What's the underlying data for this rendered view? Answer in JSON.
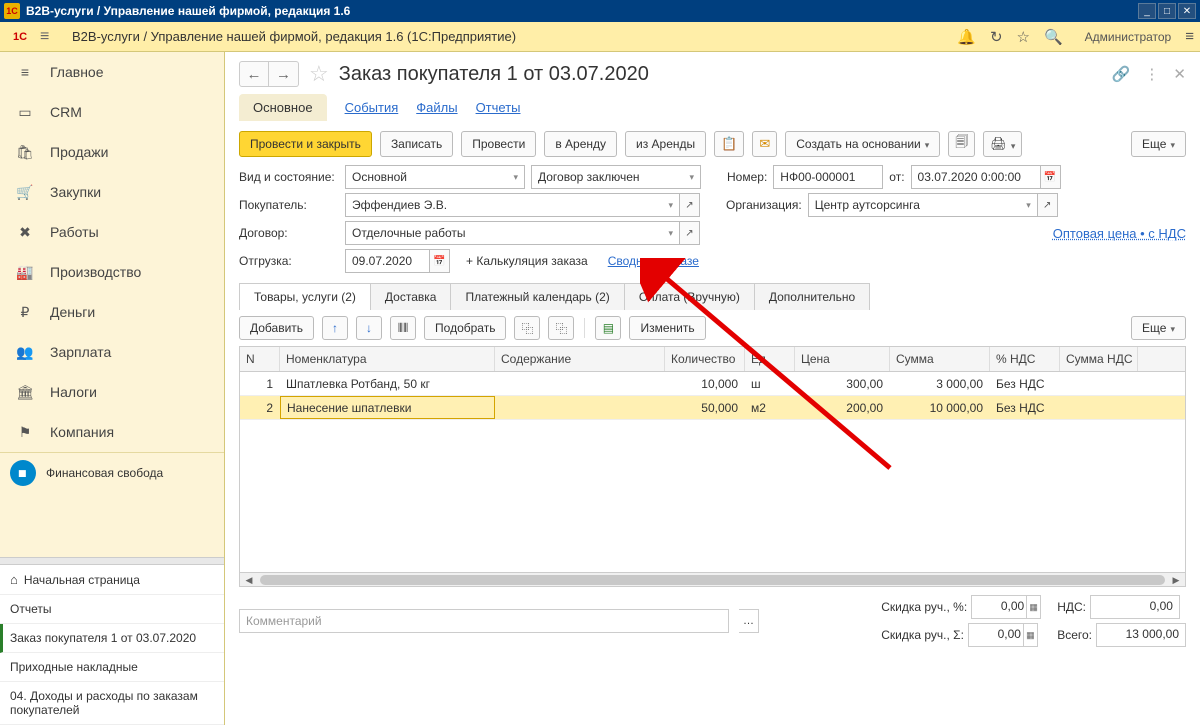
{
  "titlebar": {
    "text": "В2В-услуги / Управление нашей фирмой, редакция 1.6"
  },
  "header": {
    "breadcrumb": "В2В-услуги / Управление нашей фирмой, редакция 1.6  (1С:Предприятие)",
    "user": "Администратор"
  },
  "sidebar": {
    "items": [
      {
        "icon": "≡",
        "label": "Главное"
      },
      {
        "icon": "▭",
        "label": "CRM"
      },
      {
        "icon": "🛍",
        "label": "Продажи"
      },
      {
        "icon": "🛒",
        "label": "Закупки"
      },
      {
        "icon": "✖",
        "label": "Работы"
      },
      {
        "icon": "🏭",
        "label": "Производство"
      },
      {
        "icon": "₽",
        "label": "Деньги"
      },
      {
        "icon": "👥",
        "label": "Зарплата"
      },
      {
        "icon": "🏛",
        "label": "Налоги"
      },
      {
        "icon": "⚑",
        "label": "Компания"
      }
    ],
    "fin": "Финансовая свобода",
    "bottom": [
      "Начальная страница",
      "Отчеты",
      "Заказ покупателя 1 от 03.07.2020",
      "Приходные накладные",
      "04. Доходы и расходы по заказам покупателей"
    ]
  },
  "doc": {
    "title": "Заказ покупателя 1 от 03.07.2020",
    "tabs": {
      "main": "Основное",
      "events": "События",
      "files": "Файлы",
      "reports": "Отчеты"
    },
    "cmd": {
      "post_close": "Провести и закрыть",
      "save": "Записать",
      "post": "Провести",
      "rent_to": "в Аренду",
      "rent_from": "из Аренды",
      "create_base": "Создать на основании",
      "more": "Еще"
    },
    "fields": {
      "type_label": "Вид и состояние:",
      "type_val": "Основной",
      "status_val": "Договор заключен",
      "num_label": "Номер:",
      "num_val": "НФ00-000001",
      "from_label": "от:",
      "from_val": "03.07.2020  0:00:00",
      "buyer_label": "Покупатель:",
      "buyer_val": "Эффендиев Э.В.",
      "org_label": "Организация:",
      "org_val": "Центр аутсорсинга",
      "contract_label": "Договор:",
      "contract_val": "Отделочные работы",
      "price_link": "Оптовая цена • с НДС",
      "ship_label": "Отгрузка:",
      "ship_val": "09.07.2020",
      "calc_link": "+ Калькуляция заказа",
      "summary_link": "Сводно о заказе"
    },
    "inner_tabs": [
      "Товары, услуги (2)",
      "Доставка",
      "Платежный календарь (2)",
      "Оплата (Вручную)",
      "Дополнительно"
    ],
    "tbl_cmd": {
      "add": "Добавить",
      "pick": "Подобрать",
      "edit": "Изменить",
      "more": "Еще"
    },
    "cols": {
      "n": "N",
      "nom": "Номенклатура",
      "cont": "Содержание",
      "qty": "Количество",
      "unit": "Ед.",
      "price": "Цена",
      "sum": "Сумма",
      "vat": "% НДС",
      "vatsum": "Сумма НДС"
    },
    "rows": [
      {
        "n": "1",
        "nom": "Шпатлевка Ротбанд, 50 кг",
        "cont": "",
        "qty": "10,000",
        "unit": "ш",
        "price": "300,00",
        "sum": "3 000,00",
        "vat": "Без НДС",
        "vatsum": ""
      },
      {
        "n": "2",
        "nom": "Нанесение шпатлевки",
        "cont": "",
        "qty": "50,000",
        "unit": "м2",
        "price": "200,00",
        "sum": "10 000,00",
        "vat": "Без НДС",
        "vatsum": ""
      }
    ],
    "footer": {
      "comment_ph": "Комментарий",
      "disc_pct_label": "Скидка руч., %:",
      "disc_pct_val": "0,00",
      "disc_sum_label": "Скидка руч., Σ:",
      "disc_sum_val": "0,00",
      "vat_label": "НДС:",
      "vat_val": "0,00",
      "total_label": "Всего:",
      "total_val": "13 000,00"
    }
  }
}
